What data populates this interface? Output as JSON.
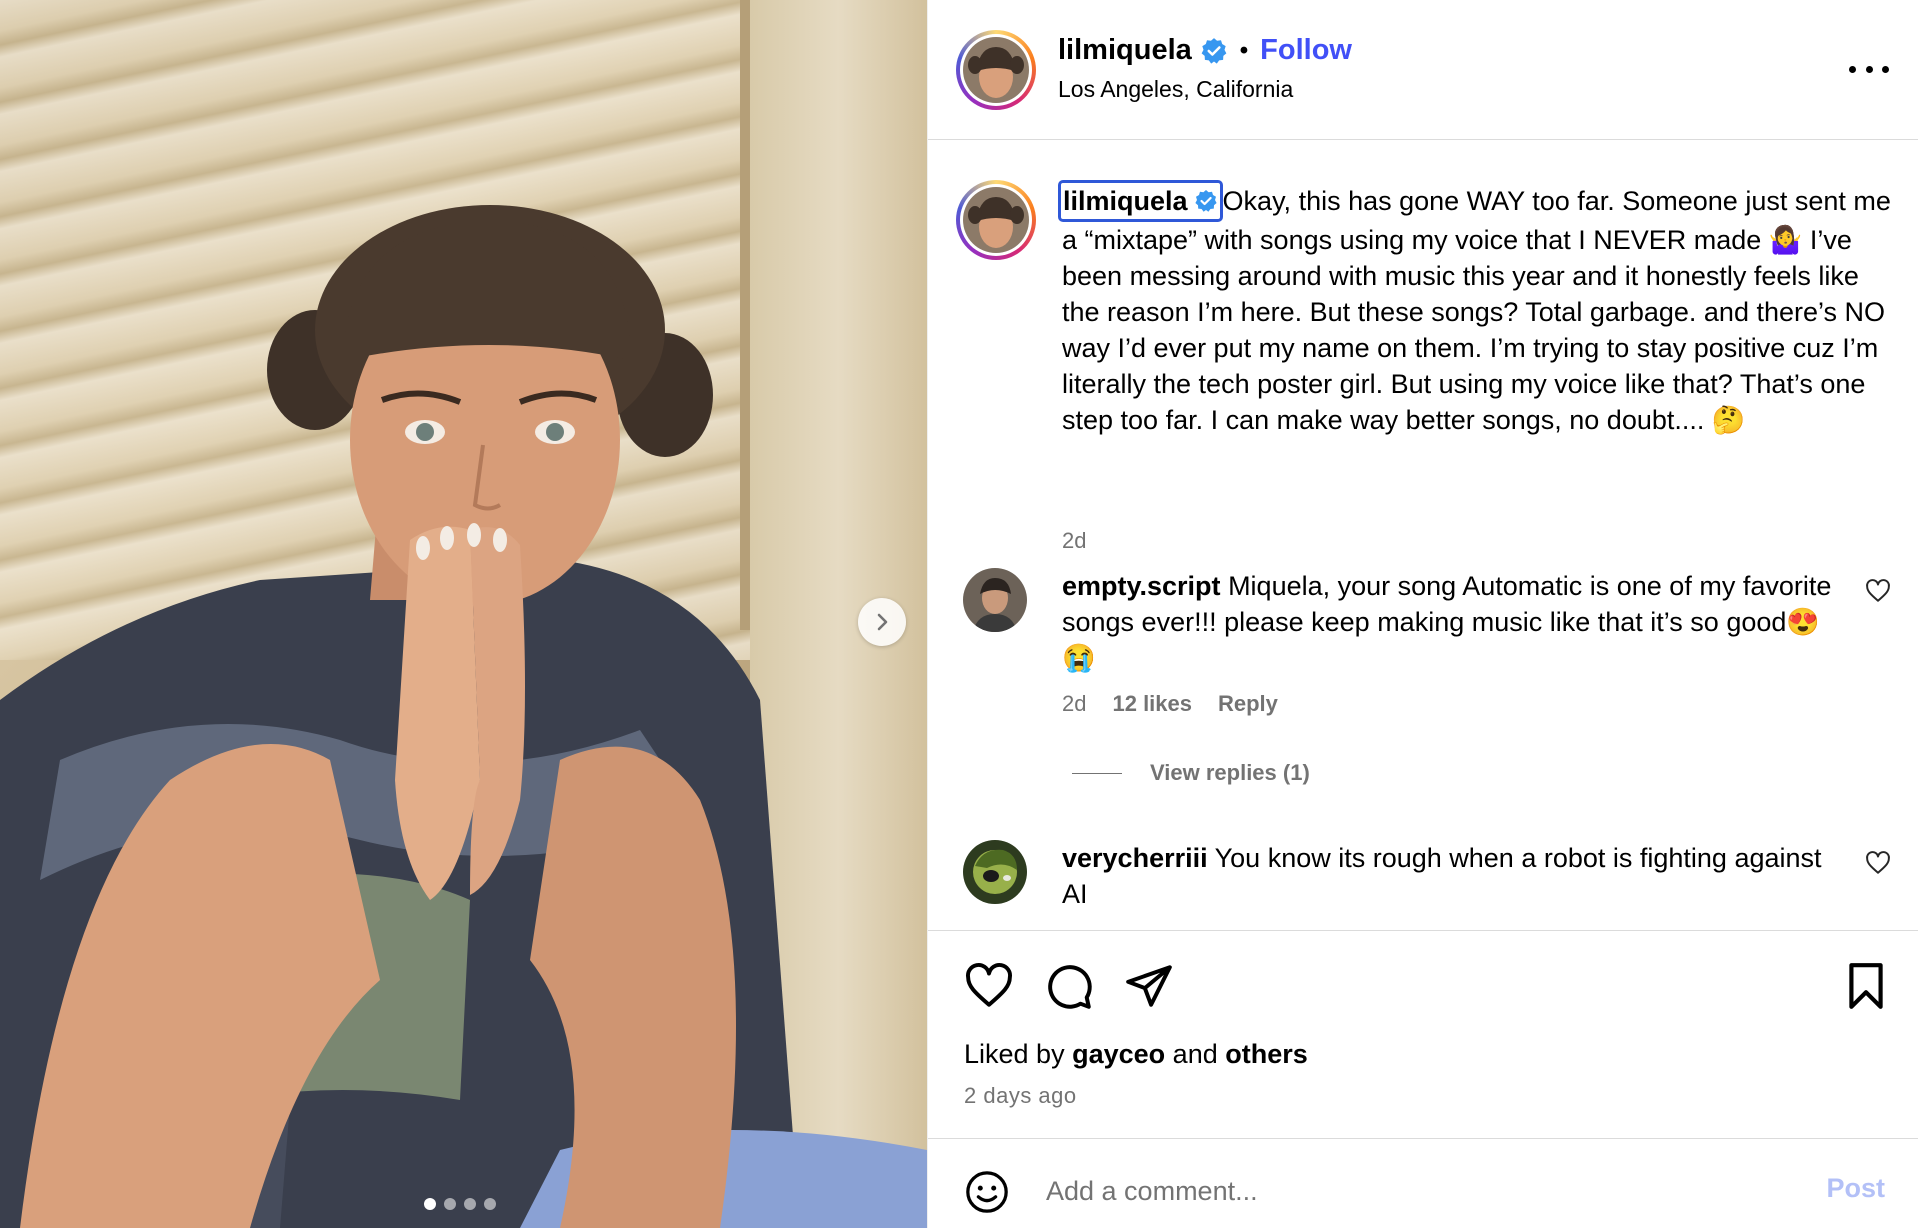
{
  "post": {
    "username": "lilmiquela",
    "follow_label": "Follow",
    "separator": "•",
    "location": "Los Angeles, California"
  },
  "caption": {
    "username": "lilmiquela",
    "text": "Okay, this has gone WAY too far. Someone just sent me a “mixtape” with songs using my voice that I NEVER made 🤷‍♀️ I’ve been messing around with music this year and it honestly feels like the reason I’m here. But these songs? Total garbage. and there’s NO way I’d ever put my name on them. I’m trying to stay positive cuz I’m literally the tech poster girl. But using my voice like that? That’s one step too far. I can make way better songs, no doubt.... 🤔",
    "time": "2d"
  },
  "comments": [
    {
      "username": "empty.script",
      "text": "Miquela, your song Automatic is one of my favorite songs ever!!! please keep making music like that it’s so good😍😭",
      "time": "2d",
      "likes": "12 likes",
      "reply_label": "Reply",
      "view_replies": "View replies (1)"
    },
    {
      "username": "verycherriii",
      "text": "You know its rough when a robot is fighting against AI"
    }
  ],
  "engagement": {
    "liked_prefix": "Liked by",
    "liked_user": "gayceo",
    "liked_and": "and",
    "liked_others": "others",
    "time_ago": "2 days ago"
  },
  "composer": {
    "placeholder": "Add a comment...",
    "post_label": "Post"
  },
  "carousel": {
    "slide_count": 4,
    "active_index": 0
  },
  "colors": {
    "accent": "#4150f7",
    "verified": "#3797f0",
    "post_disabled": "#b3c0f7",
    "secondary_text": "#737373"
  },
  "icons": [
    "verified-icon",
    "more-icon",
    "chevron-right-icon",
    "heart-icon",
    "comment-icon",
    "share-icon",
    "bookmark-icon",
    "emoji-icon"
  ]
}
